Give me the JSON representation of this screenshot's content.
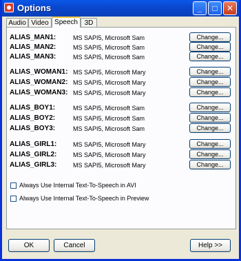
{
  "window": {
    "title": "Options"
  },
  "titlebar_buttons": {
    "minimize": "_",
    "maximize": "□",
    "close": "✕"
  },
  "tabs": [
    {
      "label": "Audio"
    },
    {
      "label": "Video"
    },
    {
      "label": "Speech"
    },
    {
      "label": "3D"
    }
  ],
  "active_tab": "Speech",
  "aliases": [
    {
      "name": "ALIAS_MAN1:",
      "voice": "MS SAPI5, Microsoft Sam",
      "button": "Change..."
    },
    {
      "name": "ALIAS_MAN2:",
      "voice": "MS SAPI5, Microsoft Sam",
      "button": "Change..."
    },
    {
      "name": "ALIAS_MAN3:",
      "voice": "MS SAPI5, Microsoft Sam",
      "button": "Change..."
    },
    {
      "name": "ALIAS_WOMAN1:",
      "voice": "MS SAPI5, Microsoft Mary",
      "button": "Change..."
    },
    {
      "name": "ALIAS_WOMAN2:",
      "voice": "MS SAPI5, Microsoft Mary",
      "button": "Change..."
    },
    {
      "name": "ALIAS_WOMAN3:",
      "voice": "MS SAPI5, Microsoft Mary",
      "button": "Change..."
    },
    {
      "name": "ALIAS_BOY1:",
      "voice": "MS SAPI5, Microsoft Sam",
      "button": "Change..."
    },
    {
      "name": "ALIAS_BOY2:",
      "voice": "MS SAPI5, Microsoft Sam",
      "button": "Change..."
    },
    {
      "name": "ALIAS_BOY3:",
      "voice": "MS SAPI5, Microsoft Sam",
      "button": "Change..."
    },
    {
      "name": "ALIAS_GIRL1:",
      "voice": "MS SAPI5, Microsoft Mary",
      "button": "Change..."
    },
    {
      "name": "ALIAS_GIRL2:",
      "voice": "MS SAPI5, Microsoft Mary",
      "button": "Change..."
    },
    {
      "name": "ALIAS_GIRL3:",
      "voice": "MS SAPI5, Microsoft Mary",
      "button": "Change..."
    }
  ],
  "checkboxes": [
    {
      "label": "Always Use Internal Text-To-Speech in AVI",
      "checked": false
    },
    {
      "label": "Always Use Internal Text-To-Speech in Preview",
      "checked": false
    }
  ],
  "footer": {
    "ok": "OK",
    "cancel": "Cancel",
    "help": "Help >>"
  },
  "colors": {
    "titlebar": "#0a58e8",
    "dialog_bg": "#ece9d8",
    "panel_bg": "#fcfcfe",
    "active_tab_accent": "#ffc83c"
  }
}
